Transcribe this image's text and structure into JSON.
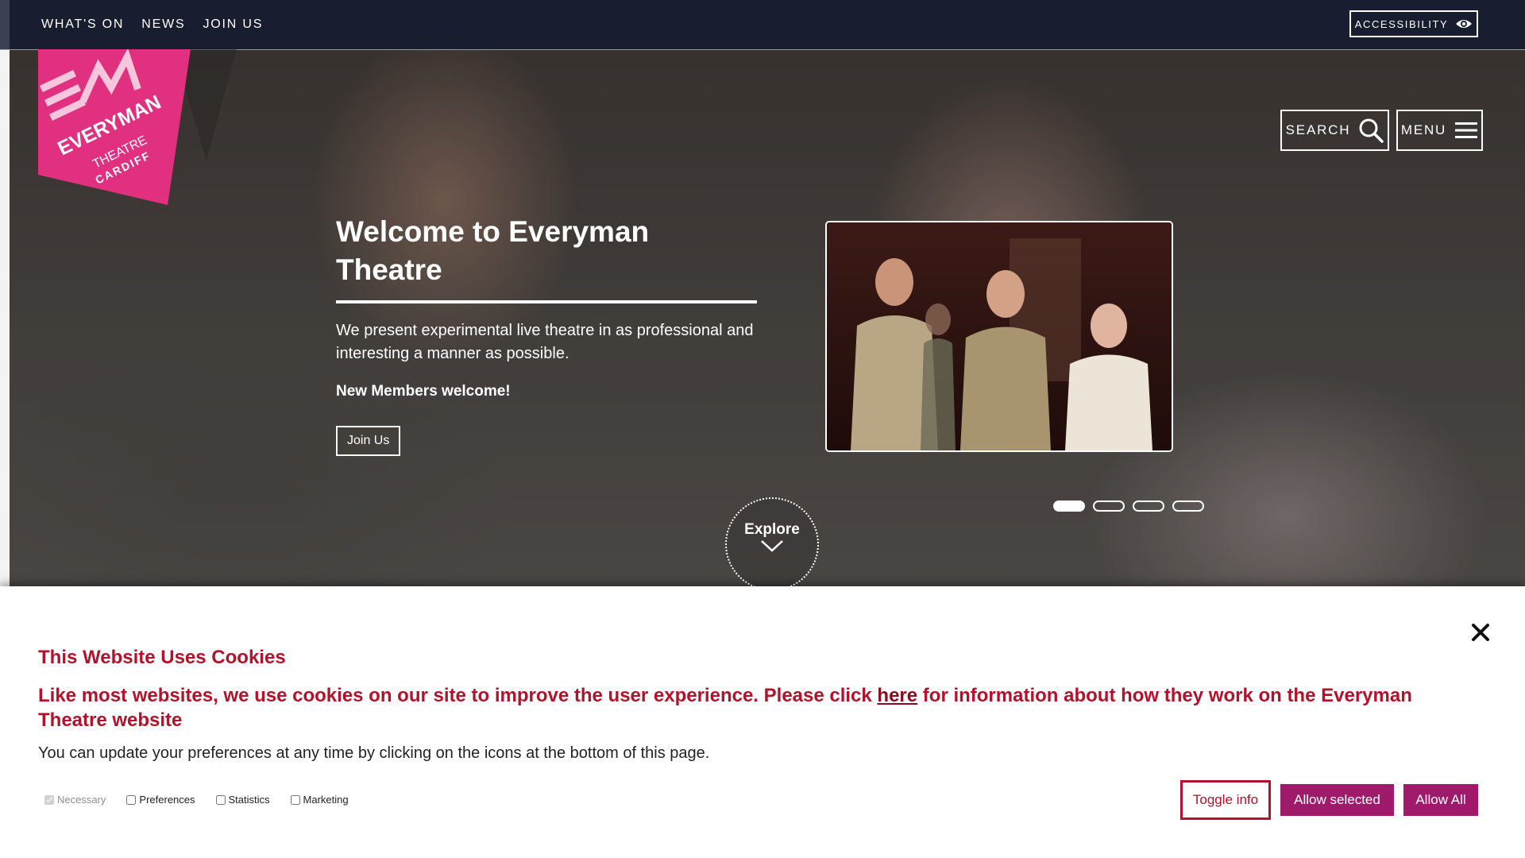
{
  "top_nav": {
    "items": [
      "WHAT'S ON",
      "NEWS",
      "JOIN US"
    ],
    "accessibility_label": "ACCESSIBILITY"
  },
  "logo": {
    "brand": "EVERYMAN",
    "line2": "THEATRE",
    "line3": "CARDIFF"
  },
  "header": {
    "search_label": "SEARCH",
    "menu_label": "MENU"
  },
  "hero": {
    "title": "Welcome to Everyman Theatre",
    "description": "We present experimental live theatre in as professional and interesting a manner as possible.",
    "members": "New Members welcome!",
    "join_label": "Join Us",
    "explore_label": "Explore",
    "slides_total": 4,
    "active_slide": 1
  },
  "cookies": {
    "title": "This Website Uses Cookies",
    "lead_before": "Like most websites, we use cookies on our site to improve the user experience. Please click ",
    "lead_link": "here",
    "lead_after": " for information about how they work on the Everyman Theatre website",
    "note": "You can update your preferences at any time by clicking on the icons at the bottom of this page.",
    "options": [
      {
        "label": "Necessary",
        "checked": true,
        "disabled": true
      },
      {
        "label": "Preferences",
        "checked": false,
        "disabled": false
      },
      {
        "label": "Statistics",
        "checked": false,
        "disabled": false
      },
      {
        "label": "Marketing",
        "checked": false,
        "disabled": false
      }
    ],
    "toggle_label": "Toggle info",
    "allow_selected_label": "Allow selected",
    "allow_all_label": "Allow All"
  },
  "colors": {
    "cookie_red": "#b3122a",
    "button_purple": "#a01a6b",
    "logo_pink": "#e0307f",
    "topbar": "#121a30"
  }
}
